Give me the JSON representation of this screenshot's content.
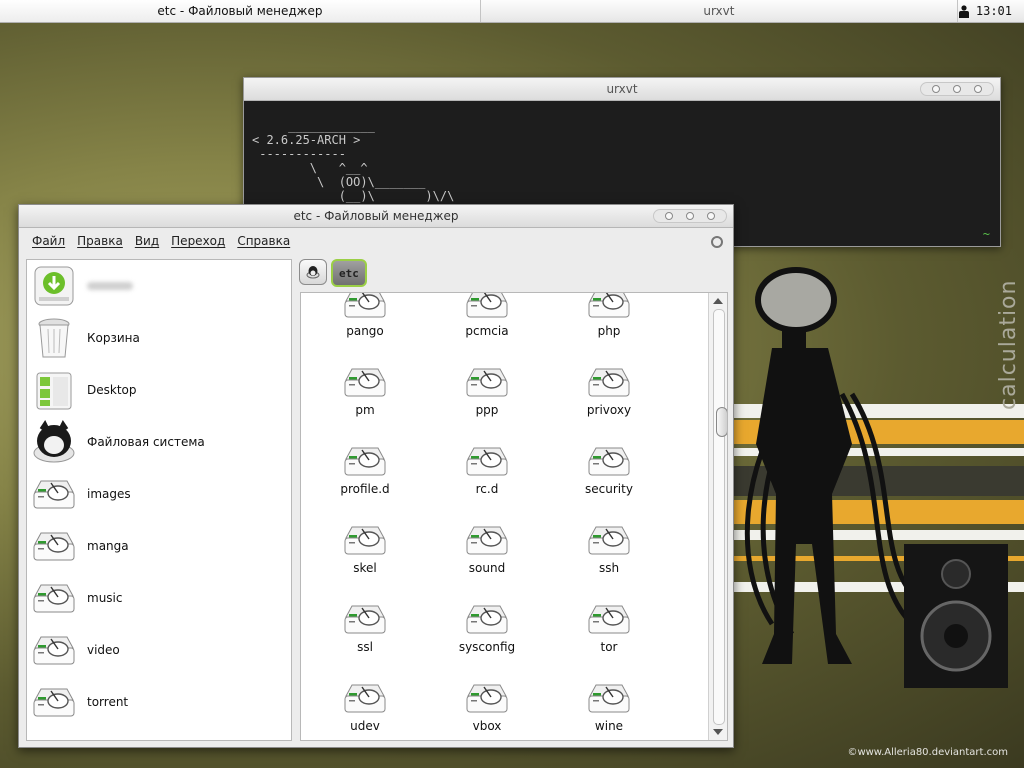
{
  "panel": {
    "tasks": [
      {
        "label": "etc - Файловый менеджер",
        "active": true
      },
      {
        "label": "urxvt",
        "active": false
      }
    ],
    "clock": "13:01",
    "user_icon": "person-icon"
  },
  "terminal": {
    "title": "urxvt",
    "lines": " ____________\n< 2.6.25-ARCH >\n ------------\n        \\   ^__^\n         \\  (OO)\\_______\n            (__)\\       )\\/\\\n                ||----w |\n                ||     ||",
    "prompt": "~"
  },
  "file_manager": {
    "title": "etc - Файловый менеджер",
    "menu": [
      {
        "label": "Файл"
      },
      {
        "label": "Правка"
      },
      {
        "label": "Вид"
      },
      {
        "label": "Переход"
      },
      {
        "label": "Справка"
      }
    ],
    "sidebar": [
      {
        "label": "",
        "icon": "usb-drive-icon",
        "blurred": true
      },
      {
        "label": "Корзина",
        "icon": "trash-icon"
      },
      {
        "label": "Desktop",
        "icon": "desktop-icon"
      },
      {
        "label": "Файловая система",
        "icon": "filesystem-icon"
      },
      {
        "label": "images",
        "icon": "folder-icon"
      },
      {
        "label": "manga",
        "icon": "folder-icon"
      },
      {
        "label": "music",
        "icon": "folder-icon"
      },
      {
        "label": "video",
        "icon": "folder-icon"
      },
      {
        "label": "torrent",
        "icon": "folder-icon"
      }
    ],
    "path": [
      {
        "label": "",
        "icon": "root-drive-icon"
      },
      {
        "label": "etc",
        "active": true
      }
    ],
    "files": [
      "pango",
      "pcmcia",
      "php",
      "pm",
      "ppp",
      "privoxy",
      "profile.d",
      "rc.d",
      "security",
      "skel",
      "sound",
      "ssh",
      "ssl",
      "sysconfig",
      "tor",
      "udev",
      "vbox",
      "wine"
    ],
    "scroll_position": 0.25
  },
  "wallpaper": {
    "signature": "©www.Alleria80.deviantart.com",
    "vertical_text": "calculation"
  }
}
